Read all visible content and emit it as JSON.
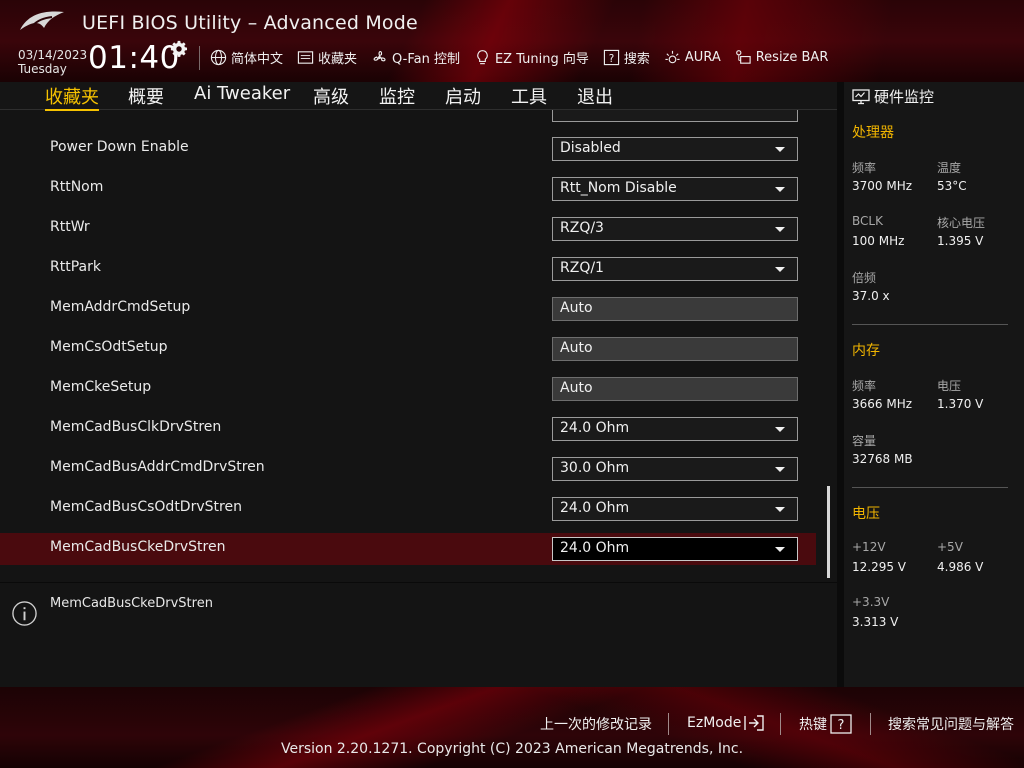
{
  "header": {
    "title": "UEFI BIOS Utility – Advanced Mode",
    "date": "03/14/2023",
    "day": "Tuesday",
    "time": "01:40",
    "toolbar": [
      {
        "label": "简体中文",
        "icon": "globe-icon"
      },
      {
        "label": "收藏夹",
        "icon": "favorites-icon"
      },
      {
        "label": "Q-Fan 控制",
        "icon": "fan-icon"
      },
      {
        "label": "EZ Tuning 向导",
        "icon": "bulb-icon"
      },
      {
        "label": "搜索",
        "icon": "search-help-icon"
      },
      {
        "label": "AURA",
        "icon": "aura-icon"
      },
      {
        "label": "Resize BAR",
        "icon": "resize-bar-icon"
      }
    ]
  },
  "tabs": [
    "收藏夹",
    "概要",
    "Ai Tweaker",
    "高级",
    "监控",
    "启动",
    "工具",
    "退出"
  ],
  "active_tab": "收藏夹",
  "settings": [
    {
      "label": "Power Down Enable",
      "value": "Disabled",
      "kind": "dropdown"
    },
    {
      "label": "RttNom",
      "value": "Rtt_Nom Disable",
      "kind": "dropdown"
    },
    {
      "label": "RttWr",
      "value": "RZQ/3",
      "kind": "dropdown"
    },
    {
      "label": "RttPark",
      "value": "RZQ/1",
      "kind": "dropdown"
    },
    {
      "label": "MemAddrCmdSetup",
      "value": "Auto",
      "kind": "text"
    },
    {
      "label": "MemCsOdtSetup",
      "value": "Auto",
      "kind": "text"
    },
    {
      "label": "MemCkeSetup",
      "value": "Auto",
      "kind": "text"
    },
    {
      "label": "MemCadBusClkDrvStren",
      "value": "24.0 Ohm",
      "kind": "dropdown"
    },
    {
      "label": "MemCadBusAddrCmdDrvStren",
      "value": "30.0 Ohm",
      "kind": "dropdown"
    },
    {
      "label": "MemCadBusCsOdtDrvStren",
      "value": "24.0 Ohm",
      "kind": "dropdown"
    },
    {
      "label": "MemCadBusCkeDrvStren",
      "value": "24.0 Ohm",
      "kind": "dropdown",
      "selected": true
    }
  ],
  "help": {
    "text": "MemCadBusCkeDrvStren"
  },
  "hardware_monitor": {
    "title": "硬件监控",
    "cpu": {
      "title": "处理器",
      "freq_label": "频率",
      "freq": "3700 MHz",
      "temp_label": "温度",
      "temp": "53°C",
      "bclk_label": "BCLK",
      "bclk": "100 MHz",
      "vcore_label": "核心电压",
      "vcore": "1.395 V",
      "ratio_label": "倍频",
      "ratio": "37.0 x"
    },
    "memory": {
      "title": "内存",
      "freq_label": "频率",
      "freq": "3666 MHz",
      "volt_label": "电压",
      "volt": "1.370 V",
      "cap_label": "容量",
      "cap": "32768 MB"
    },
    "voltage": {
      "title": "电压",
      "v12_label": "+12V",
      "v12": "12.295 V",
      "v5_label": "+5V",
      "v5": "4.986 V",
      "v33_label": "+3.3V",
      "v33": "3.313 V"
    }
  },
  "footer": {
    "last_modified": "上一次的修改记录",
    "ezmode": "EzMode",
    "hotkeys": "热键",
    "faq": "搜索常见问题与解答",
    "copyright": "Version 2.20.1271. Copyright (C) 2023 American Megatrends, Inc."
  },
  "colors": {
    "accent": "#f6c200",
    "selected_row": "#4a0a0e",
    "brand_red": "#7a0a12"
  }
}
